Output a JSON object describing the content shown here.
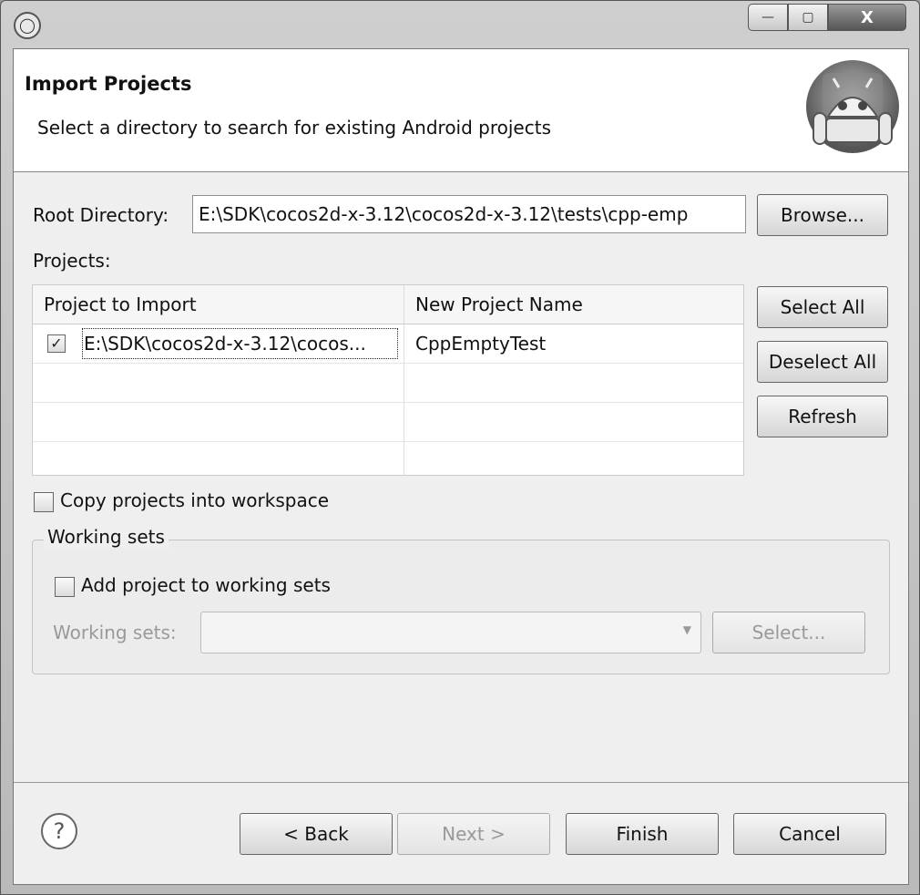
{
  "window": {
    "controls": {
      "minimize": "—",
      "maximize": "▢",
      "close": "X"
    }
  },
  "header": {
    "title": "Import Projects",
    "subtitle": "Select a directory to search for existing Android projects"
  },
  "root": {
    "label": "Root Directory:",
    "value": "E:\\SDK\\cocos2d-x-3.12\\cocos2d-x-3.12\\tests\\cpp-emp",
    "browse": "Browse..."
  },
  "projects": {
    "label": "Projects:",
    "columns": [
      "Project to Import",
      "New Project Name"
    ],
    "rows": [
      {
        "checked": true,
        "path": "E:\\SDK\\cocos2d-x-3.12\\cocos...",
        "name": "CppEmptyTest"
      }
    ],
    "buttons": {
      "select_all": "Select All",
      "deselect_all": "Deselect All",
      "refresh": "Refresh"
    }
  },
  "copy": {
    "label": "Copy projects into workspace",
    "checked": false
  },
  "working_sets": {
    "group_title": "Working sets",
    "add_label": "Add project to working sets",
    "add_checked": false,
    "field_label": "Working sets:",
    "select": "Select..."
  },
  "footer": {
    "help": "?",
    "back": "< Back",
    "next": "Next >",
    "finish": "Finish",
    "cancel": "Cancel"
  }
}
